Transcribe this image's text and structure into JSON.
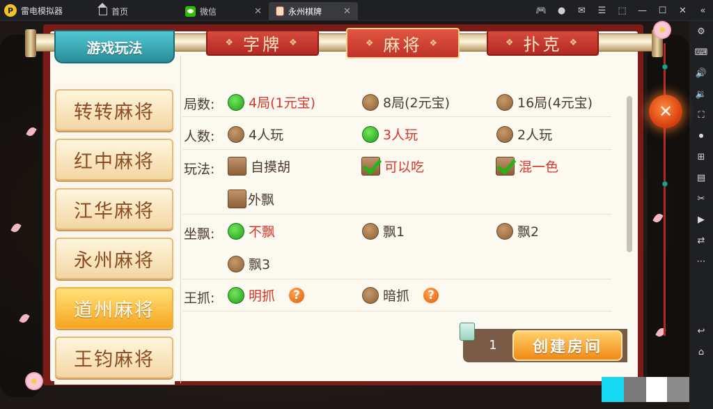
{
  "window": {
    "app_name": "雷电模拟器",
    "tabs": [
      {
        "label": "首页",
        "icon": "home-icon"
      },
      {
        "label": "微信",
        "icon": "wechat-icon"
      },
      {
        "label": "永州棋牌",
        "icon": "mahjong-tile-icon"
      }
    ]
  },
  "game": {
    "header": {
      "title": "游戏玩法",
      "categories": [
        "字牌",
        "麻将",
        "扑克"
      ],
      "active_category": "麻将"
    },
    "menu": {
      "items": [
        "转转麻将",
        "红中麻将",
        "江华麻将",
        "永州麻将",
        "道州麻将",
        "王钧麻将"
      ],
      "selected": "道州麻将"
    },
    "options": {
      "rounds": {
        "label": "局数:",
        "choices": [
          "4局(1元宝)",
          "8局(2元宝)",
          "16局(4元宝)"
        ],
        "selected": "4局(1元宝)"
      },
      "players": {
        "label": "人数:",
        "choices": [
          "4人玩",
          "3人玩",
          "2人玩"
        ],
        "selected": "3人玩"
      },
      "rules": {
        "label": "玩法:",
        "choices": [
          "自摸胡",
          "可以吃",
          "混一色",
          "外飘"
        ],
        "checked": [
          "可以吃",
          "混一色"
        ]
      },
      "piao": {
        "label": "坐飘:",
        "choices": [
          "不飘",
          "飘1",
          "飘2",
          "飘3"
        ],
        "selected": "不飘"
      },
      "zhua": {
        "label": "王抓:",
        "choices": [
          "明抓",
          "暗抓"
        ],
        "selected": "明抓"
      }
    },
    "footer": {
      "count": "1",
      "create_label": "创建房间"
    }
  },
  "colors": {
    "accent_red": "#d9352a",
    "selected_green": "#1e9f1b",
    "panel_border": "#7a1b18",
    "button_orange": "#f08a16"
  }
}
